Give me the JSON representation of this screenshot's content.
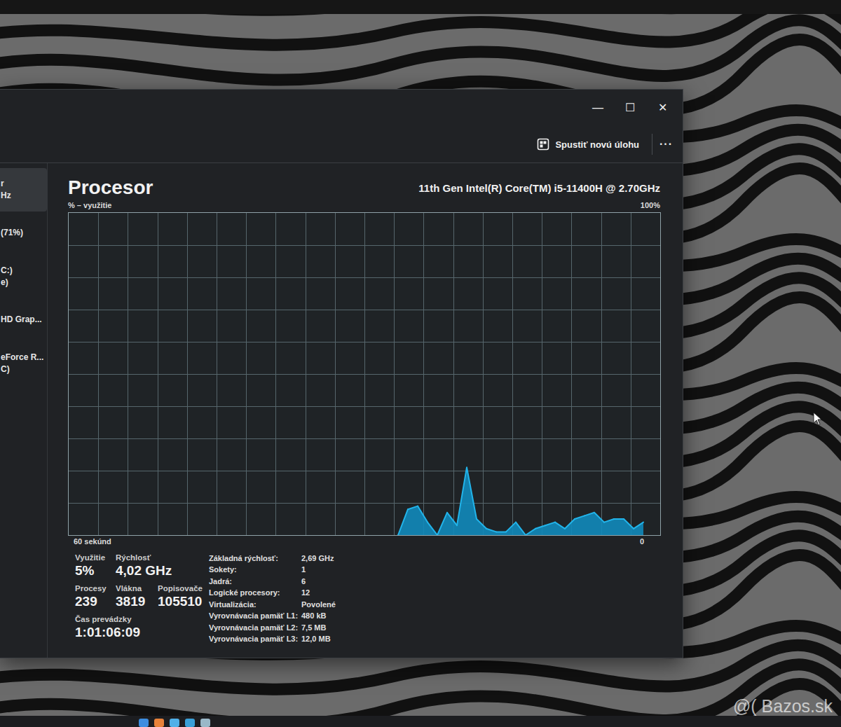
{
  "window": {
    "controls": [
      "—",
      "☐",
      "✕"
    ]
  },
  "command_bar": {
    "button": "Spustiť novú úlohu",
    "more": "···"
  },
  "sidebar": {
    "items": [
      {
        "lines": [
          "r",
          "Hz"
        ],
        "selected": true
      },
      {
        "lines": [
          "(71%)"
        ],
        "selected": false
      },
      {
        "lines": [
          "C:)",
          "e)"
        ],
        "selected": false
      },
      {
        "lines": [
          "HD Grap..."
        ],
        "selected": false
      },
      {
        "lines": [
          "eForce R...",
          "C)"
        ],
        "selected": false
      }
    ]
  },
  "page": {
    "title": "Procesor",
    "model": "11th Gen Intel(R) Core(TM) i5-11400H @ 2.70GHz"
  },
  "chart": {
    "y_label": "% – využitie",
    "y_max": "100%",
    "x_label": "60 sekúnd",
    "x_min": "0",
    "series": [
      {
        "values": [
          0,
          8,
          9,
          4,
          0,
          7,
          3,
          21,
          5,
          2,
          1,
          1,
          4,
          0,
          2,
          3,
          4,
          2,
          5,
          6,
          7,
          4,
          5,
          5,
          2,
          4
        ]
      }
    ]
  },
  "stats": {
    "rows": [
      [
        {
          "label": "Využitie",
          "value": "5%"
        },
        {
          "label": "Rýchlosť",
          "value": "4,02 GHz"
        }
      ],
      [
        {
          "label": "Procesy",
          "value": "239"
        },
        {
          "label": "Vlákna",
          "value": "3819"
        },
        {
          "label": "Popisovače",
          "value": "105510"
        }
      ],
      [
        {
          "label": "Čas prevádzky",
          "value": "1:01:06:09"
        }
      ]
    ]
  },
  "details": [
    {
      "label": "Základná rýchlosť:",
      "value": "2,69 GHz"
    },
    {
      "label": "Sokety:",
      "value": "1"
    },
    {
      "label": "Jadrá:",
      "value": "6"
    },
    {
      "label": "Logické procesory:",
      "value": "12"
    },
    {
      "label": "Virtualizácia:",
      "value": "Povolené"
    },
    {
      "label": "Vyrovnávacia pamäť L1:",
      "value": "480 kB"
    },
    {
      "label": "Vyrovnávacia pamäť L2:",
      "value": "7,5 MB"
    },
    {
      "label": "Vyrovnávacia pamäť L3:",
      "value": "12,0 MB"
    }
  ],
  "watermark": "@( Bazos.sk"
}
